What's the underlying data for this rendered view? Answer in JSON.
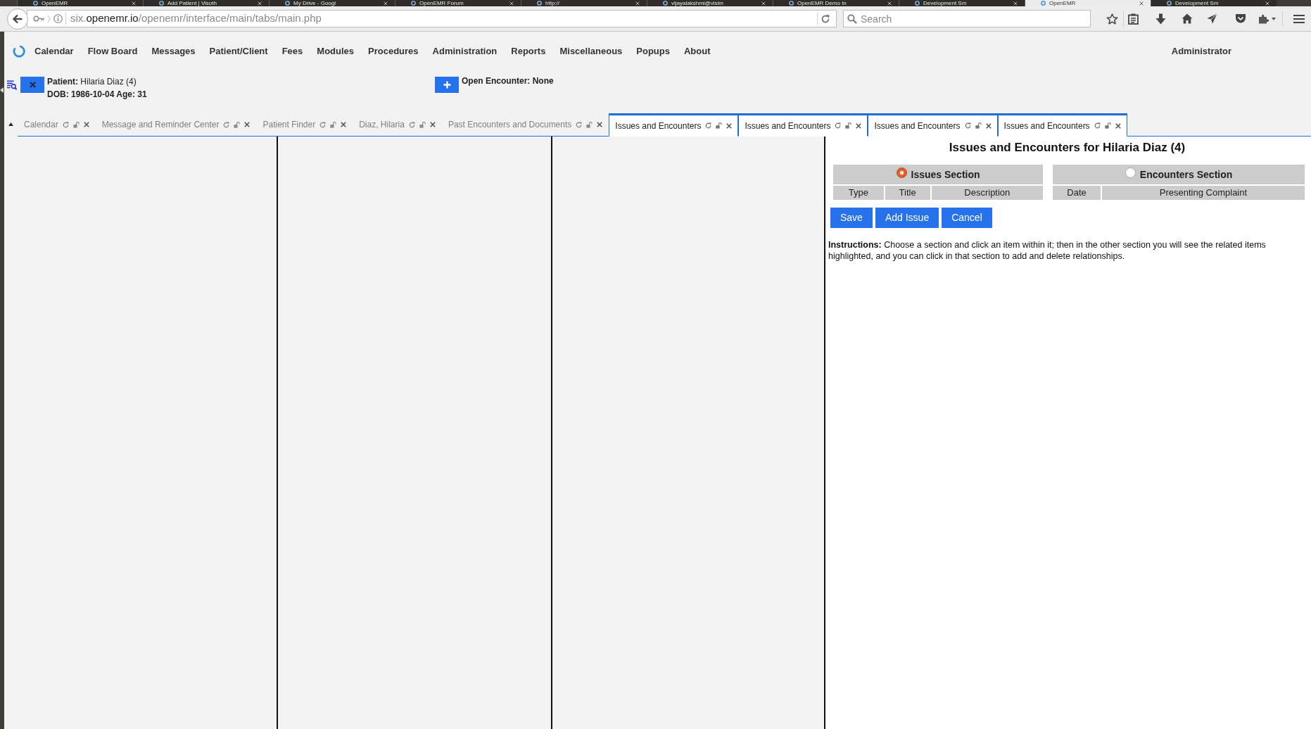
{
  "browser": {
    "tabs": [
      {
        "title": "OpenEMR",
        "selected": false
      },
      {
        "title": "Add Patient | Visoth",
        "selected": false
      },
      {
        "title": "My Drive - Googl",
        "selected": false
      },
      {
        "title": "OpenEMR Forum",
        "selected": false
      },
      {
        "title": "http://",
        "selected": false
      },
      {
        "title": "vijayalakshmi@visim",
        "selected": false
      },
      {
        "title": "OpenEMR Demo In",
        "selected": false
      },
      {
        "title": "Development Sm",
        "selected": false
      },
      {
        "title": "OpenEMR",
        "selected": true
      },
      {
        "title": "Development Sm",
        "selected": false
      }
    ],
    "address": {
      "subdomain": "six.",
      "domain": "openemr.io",
      "path": "/openemr/interface/main/tabs/main.php"
    },
    "search": {
      "placeholder": "Search"
    }
  },
  "app_menu": {
    "items": [
      "Calendar",
      "Flow Board",
      "Messages",
      "Patient/Client",
      "Fees",
      "Modules",
      "Procedures",
      "Administration",
      "Reports",
      "Miscellaneous",
      "Popups",
      "About"
    ],
    "user": "Administrator"
  },
  "patient": {
    "name_line": "**Patient:** Hilaria Diaz (4)",
    "dob_line": "DOB: 1986-10-04 Age: 31"
  },
  "encounter": {
    "status": "Open Encounter: None"
  },
  "tabs": [
    {
      "label": "Calendar",
      "selected": false
    },
    {
      "label": "Message and Reminder Center",
      "selected": false
    },
    {
      "label": "Patient Finder",
      "selected": false
    },
    {
      "label": "Diaz, Hilaria",
      "selected": false
    },
    {
      "label": "Past Encounters and Documents",
      "selected": false
    },
    {
      "label": "Issues and Encounters",
      "selected": true
    },
    {
      "label": "Issues and Encounters",
      "selected": true
    },
    {
      "label": "Issues and Encounters",
      "selected": true
    },
    {
      "label": "Issues and Encounters",
      "selected": true
    }
  ],
  "issues_page": {
    "title": "Issues and Encounters for Hilaria Diaz (4)",
    "sections": [
      {
        "label": "Issues Section",
        "selected": true,
        "columns": [
          "Type",
          "Title",
          "Description"
        ]
      },
      {
        "label": "Encounters Section",
        "selected": false,
        "columns": [
          "Date",
          "Presenting Complaint"
        ]
      }
    ],
    "buttons": [
      "Save",
      "Add Issue",
      "Cancel"
    ],
    "instructions": "**Instructions:** Choose a section and click an item within it; then in the other section you will see the related items highlighted, and you can click in that section to add and delete relationships."
  }
}
